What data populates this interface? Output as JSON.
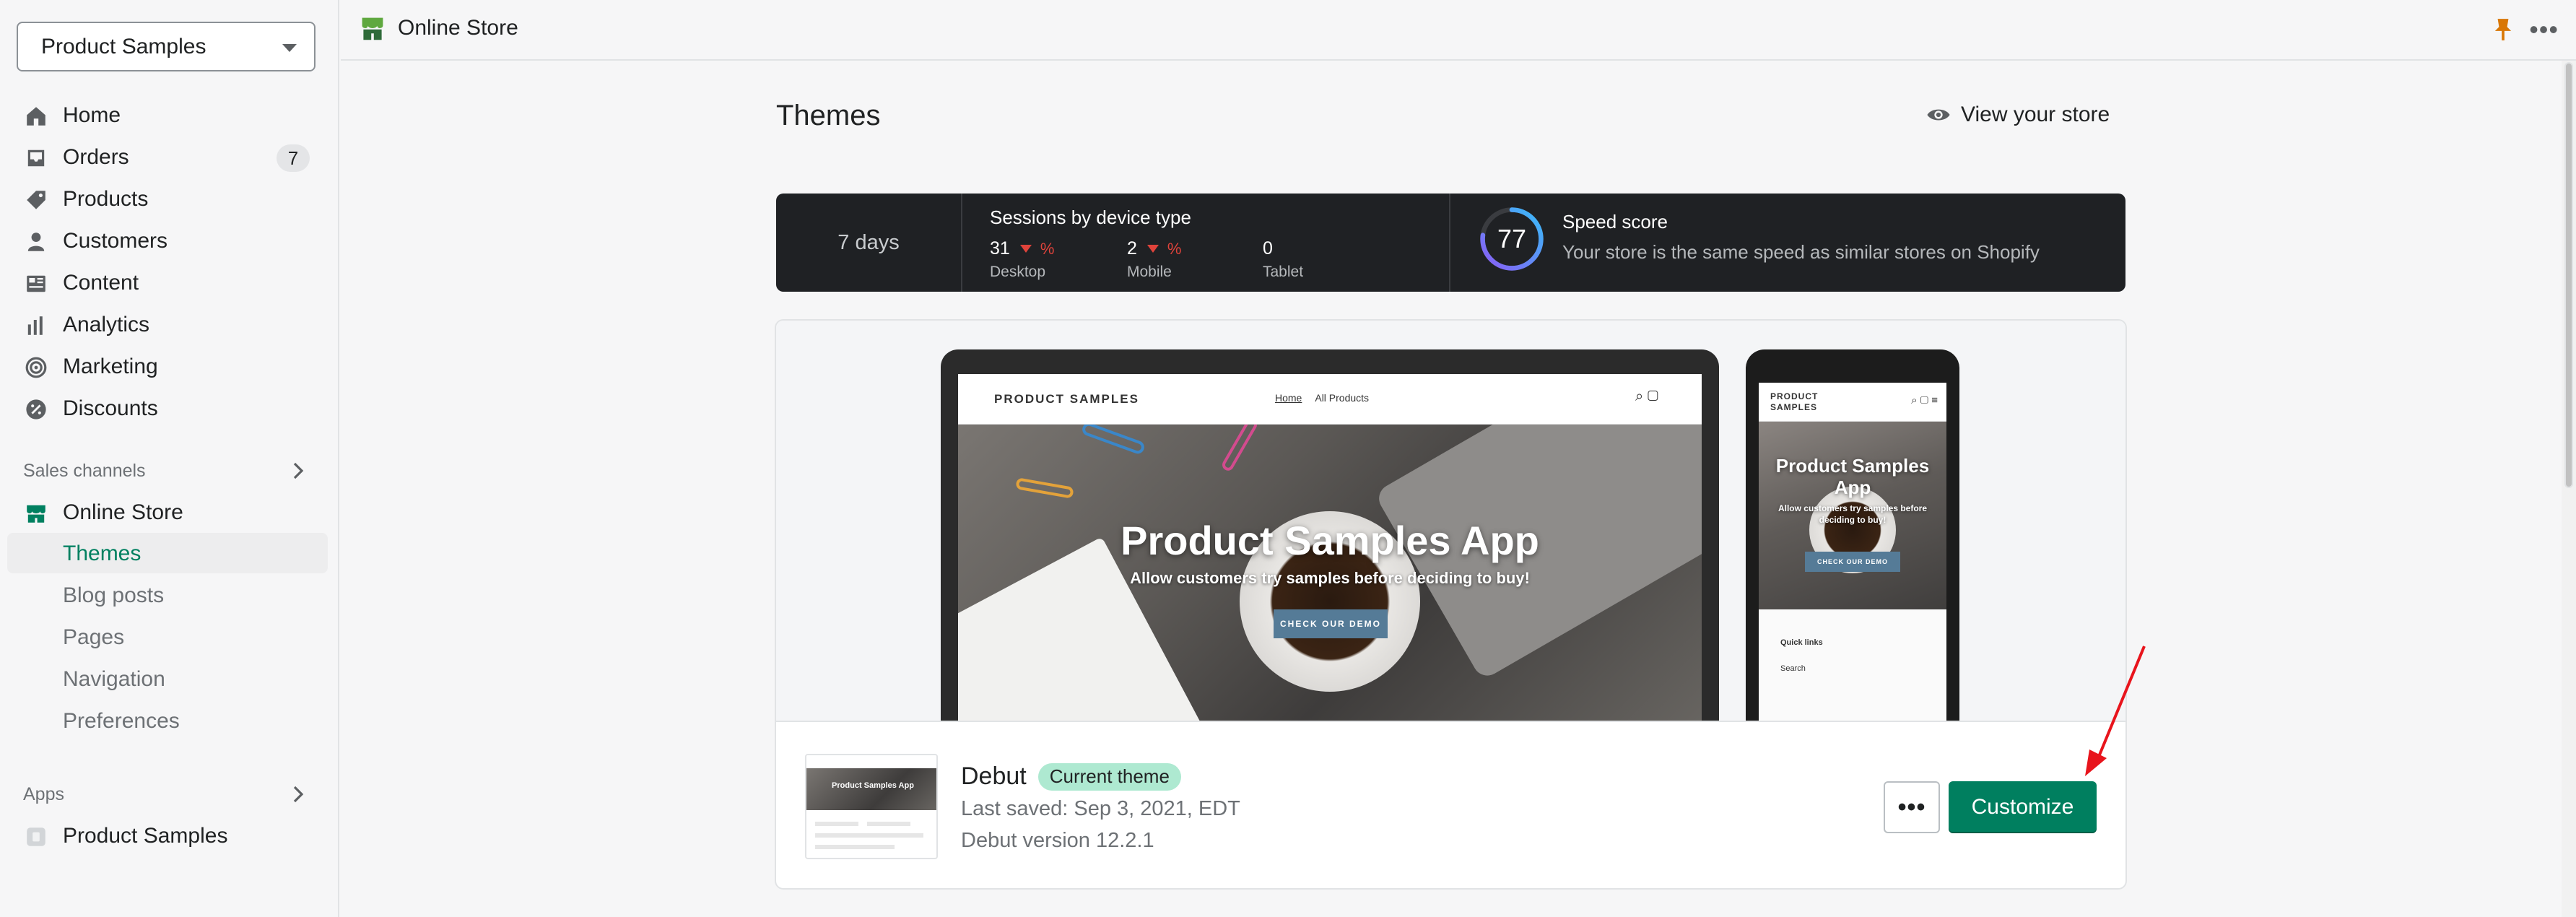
{
  "sidebar": {
    "store_name": "Product Samples",
    "nav": [
      {
        "label": "Home",
        "icon": "home-icon"
      },
      {
        "label": "Orders",
        "icon": "orders-icon",
        "badge": "7"
      },
      {
        "label": "Products",
        "icon": "tag-icon"
      },
      {
        "label": "Customers",
        "icon": "person-icon"
      },
      {
        "label": "Content",
        "icon": "content-icon"
      },
      {
        "label": "Analytics",
        "icon": "bar-chart-icon"
      },
      {
        "label": "Marketing",
        "icon": "target-icon"
      },
      {
        "label": "Discounts",
        "icon": "discount-icon"
      }
    ],
    "sales_channels_label": "Sales channels",
    "online_store_label": "Online Store",
    "online_store_sub": [
      "Themes",
      "Blog posts",
      "Pages",
      "Navigation",
      "Preferences"
    ],
    "apps_label": "Apps",
    "app_item": "Product Samples"
  },
  "topbar": {
    "title": "Online Store",
    "more": "•••"
  },
  "page": {
    "title": "Themes",
    "view_store": "View your store"
  },
  "stats": {
    "period": "7 days",
    "sessions_title": "Sessions by device type",
    "desktop_value": "31",
    "desktop_pct": "%",
    "desktop_label": "Desktop",
    "mobile_value": "2",
    "mobile_pct": "%",
    "mobile_label": "Mobile",
    "tablet_value": "0",
    "tablet_label": "Tablet",
    "speed_score": "77",
    "speed_title": "Speed score",
    "speed_desc": "Your store is the same speed as similar stores on Shopify"
  },
  "preview": {
    "brand": "PRODUCT SAMPLES",
    "nav_home": "Home",
    "nav_all": "All Products",
    "hero_title": "Product Samples App",
    "hero_sub": "Allow customers try samples before deciding to buy!",
    "cta": "CHECK OUR DEMO",
    "mobile_brand": "PRODUCT SAMPLES",
    "mobile_hero_title": "Product Samples App",
    "mobile_hero_sub": "Allow customers try samples before deciding to buy!",
    "mobile_cta": "CHECK OUR DEMO",
    "quick_links": "Quick links",
    "search": "Search"
  },
  "theme": {
    "name": "Debut",
    "badge": "Current theme",
    "last_saved": "Last saved: Sep 3, 2021, EDT",
    "version": "Debut version 12.2.1",
    "more_label": "•••",
    "customize": "Customize",
    "thumb_title": "Product Samples App"
  },
  "colors": {
    "primary": "#007f5f",
    "active_nav": "#008060",
    "badge_green": "#aee9d1",
    "stats_bg": "#1f2124",
    "decrease": "#e0433b",
    "annotation_arrow": "#e8141c"
  }
}
